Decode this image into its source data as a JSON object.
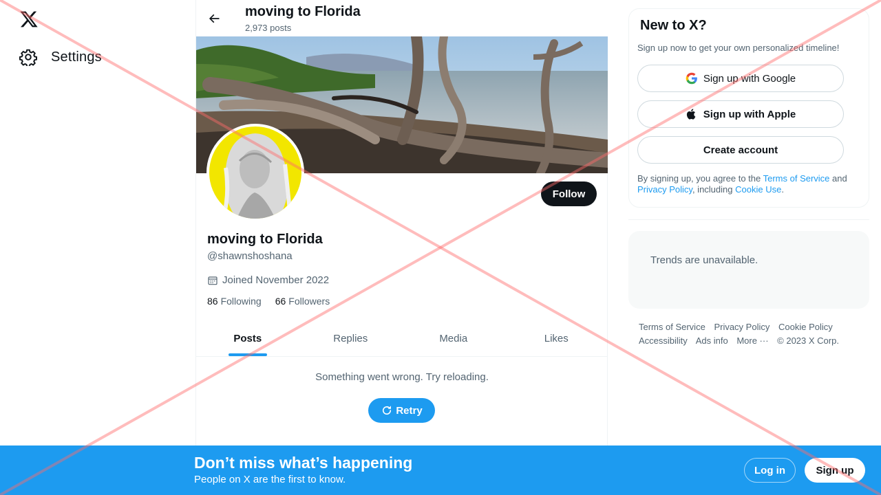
{
  "left_nav": {
    "logo_icon": "x-logo-icon",
    "settings_label": "Settings",
    "settings_icon": "gear-icon"
  },
  "header": {
    "title": "moving to Florida",
    "post_count": "2,973 posts"
  },
  "profile": {
    "name": "moving to Florida",
    "handle": "@shawnshoshana",
    "joined": "Joined November 2022",
    "following_count": "86",
    "following_label": "Following",
    "followers_count": "66",
    "followers_label": "Followers",
    "follow_label": "Follow"
  },
  "tabs": [
    {
      "label": "Posts",
      "active": true
    },
    {
      "label": "Replies",
      "active": false
    },
    {
      "label": "Media",
      "active": false
    },
    {
      "label": "Likes",
      "active": false
    }
  ],
  "feed": {
    "error_text": "Something went wrong. Try reloading.",
    "retry_label": "Retry"
  },
  "signup_card": {
    "title": "New to X?",
    "subtitle": "Sign up now to get your own personalized timeline!",
    "google_label": "Sign up with Google",
    "apple_label": "Sign up with Apple",
    "create_label": "Create account",
    "legal_prefix": "By signing up, you agree to the ",
    "terms_link": "Terms of Service",
    "legal_and": " and ",
    "privacy_link": "Privacy Policy",
    "legal_including": ", including ",
    "cookie_link": "Cookie Use",
    "legal_end": "."
  },
  "trends": {
    "message": "Trends are unavailable."
  },
  "footer": {
    "terms": "Terms of Service",
    "privacy": "Privacy Policy",
    "cookie": "Cookie Policy",
    "accessibility": "Accessibility",
    "ads": "Ads info",
    "more": "More ···",
    "copyright": "© 2023 X Corp."
  },
  "bottom_bar": {
    "title": "Don’t miss what’s happening",
    "subtitle": "People on X are the first to know.",
    "login_label": "Log in",
    "signup_label": "Sign up"
  },
  "colors": {
    "accent": "#1d9bf0",
    "text_primary": "#0f1419",
    "text_secondary": "#536471",
    "overlay_cross": "#ff6b6b"
  }
}
